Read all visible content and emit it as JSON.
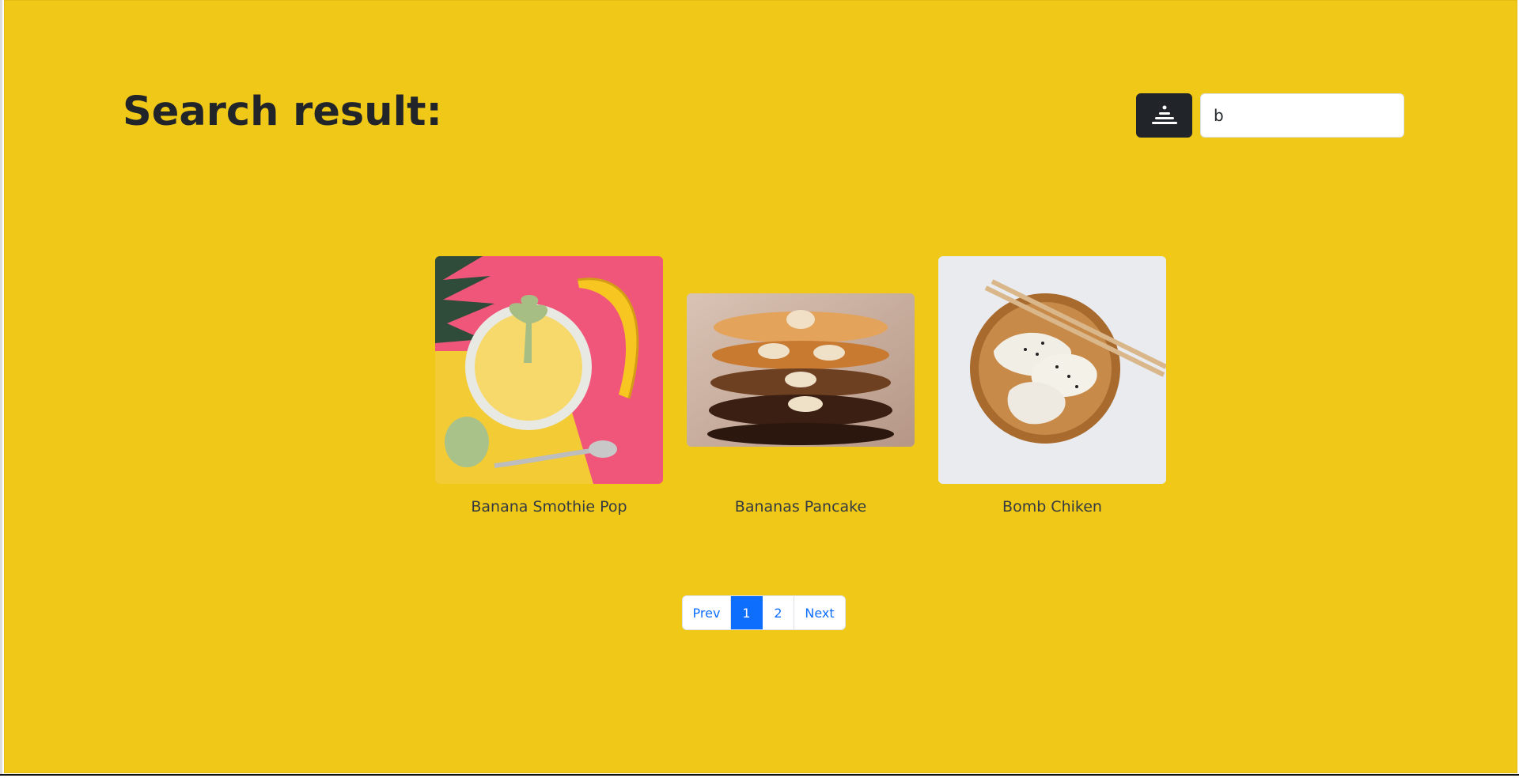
{
  "header": {
    "title": "Search result:",
    "filter_icon": "filter-icon"
  },
  "search": {
    "value": "b",
    "placeholder": ""
  },
  "results": [
    {
      "title": "Banana Smothie Pop",
      "image": "banana-smoothie-image"
    },
    {
      "title": "Bananas Pancake",
      "image": "banana-pancake-image"
    },
    {
      "title": "Bomb Chiken",
      "image": "dumplings-image"
    }
  ],
  "pagination": {
    "prev": "Prev",
    "pages": [
      "1",
      "2"
    ],
    "active": "1",
    "next": "Next"
  },
  "colors": {
    "background": "#f0c818",
    "button_dark": "#212529",
    "link": "#0d6efd",
    "active": "#0d6efd"
  }
}
